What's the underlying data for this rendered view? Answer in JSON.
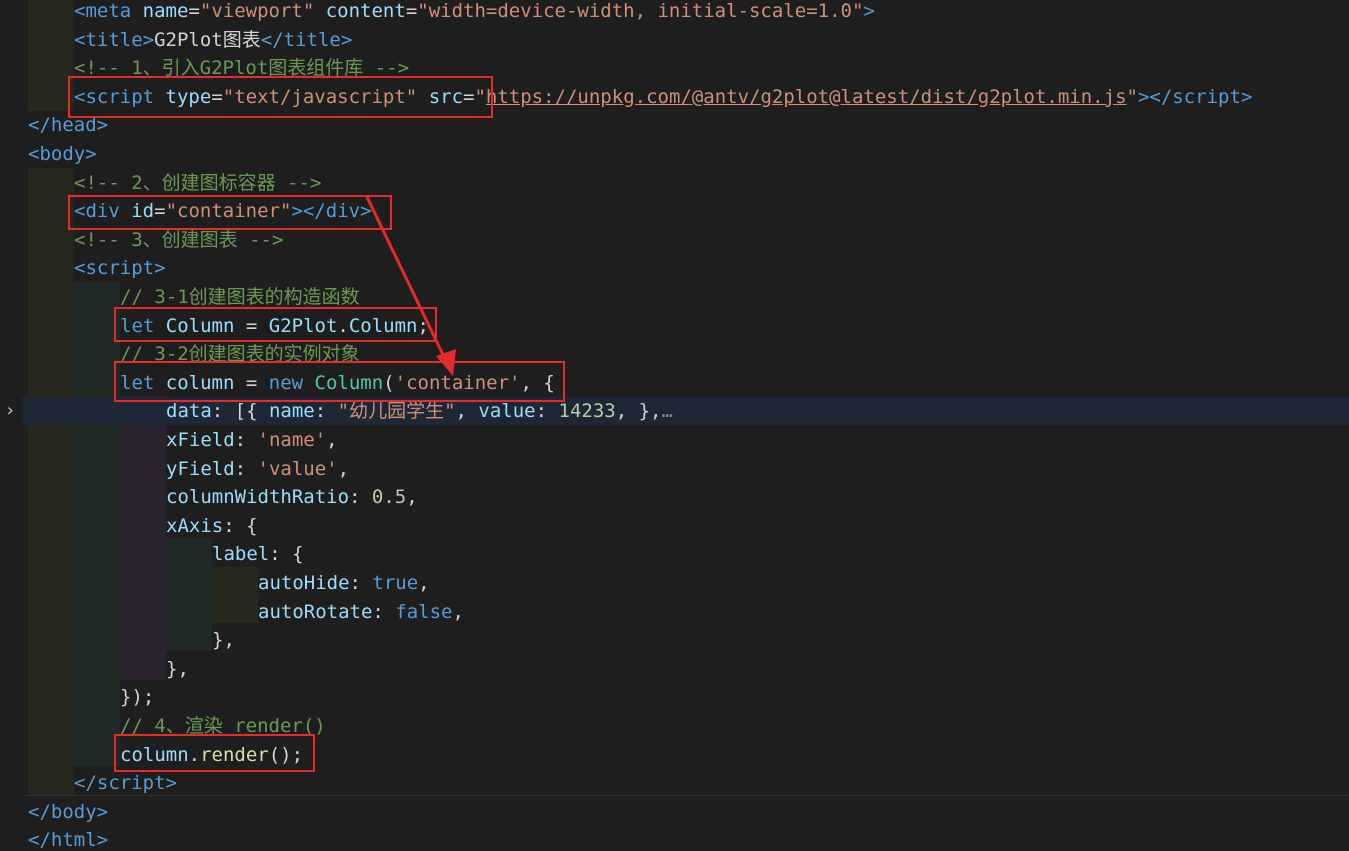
{
  "editor": {
    "colors": {
      "background": "#1e1e1e",
      "current_line": "#1d2736",
      "annotation_red": "#e52b2b"
    },
    "fold_icon": "chevron-right-icon",
    "lines": [
      [
        {
          "t": "<",
          "c": "tag"
        },
        {
          "t": "meta",
          "c": "tag"
        },
        {
          "t": " "
        },
        {
          "t": "name",
          "c": "attr"
        },
        {
          "t": "="
        },
        {
          "t": "\"viewport\"",
          "c": "str"
        },
        {
          "t": " "
        },
        {
          "t": "content",
          "c": "attr"
        },
        {
          "t": "="
        },
        {
          "t": "\"width=device-width, initial-scale=1.0\"",
          "c": "str"
        },
        {
          "t": ">",
          "c": "tag"
        }
      ],
      [
        {
          "t": "<",
          "c": "tag"
        },
        {
          "t": "title",
          "c": "tag"
        },
        {
          "t": ">",
          "c": "tag"
        },
        {
          "t": "G2Plot图表",
          "c": "plain"
        },
        {
          "t": "</",
          "c": "tag"
        },
        {
          "t": "title",
          "c": "tag"
        },
        {
          "t": ">",
          "c": "tag"
        }
      ],
      [
        {
          "t": "<!-- 1、引入G2Plot图表组件库 -->",
          "c": "cmt"
        }
      ],
      [
        {
          "t": "<",
          "c": "tag"
        },
        {
          "t": "script",
          "c": "tag"
        },
        {
          "t": " "
        },
        {
          "t": "type",
          "c": "attr"
        },
        {
          "t": "="
        },
        {
          "t": "\"text/javascript\"",
          "c": "str"
        },
        {
          "t": " "
        },
        {
          "t": "src",
          "c": "attr"
        },
        {
          "t": "="
        },
        {
          "t": "\"",
          "c": "str"
        },
        {
          "t": "https://unpkg.com/@antv/g2plot@latest/dist/g2plot.min.js",
          "c": "str link"
        },
        {
          "t": "\"",
          "c": "str"
        },
        {
          "t": "></",
          "c": "tag"
        },
        {
          "t": "script",
          "c": "tag"
        },
        {
          "t": ">",
          "c": "tag"
        }
      ],
      [
        {
          "t": "</",
          "c": "tag"
        },
        {
          "t": "head",
          "c": "tag"
        },
        {
          "t": ">",
          "c": "tag"
        }
      ],
      [
        {
          "t": "<",
          "c": "tag"
        },
        {
          "t": "body",
          "c": "tag"
        },
        {
          "t": ">",
          "c": "tag"
        }
      ],
      [
        {
          "t": "<!-- 2、创建图标容器 -->",
          "c": "cmt"
        }
      ],
      [
        {
          "t": "<",
          "c": "tag"
        },
        {
          "t": "div",
          "c": "tag"
        },
        {
          "t": " "
        },
        {
          "t": "id",
          "c": "attr"
        },
        {
          "t": "="
        },
        {
          "t": "\"container\"",
          "c": "str"
        },
        {
          "t": "></",
          "c": "tag"
        },
        {
          "t": "div",
          "c": "tag"
        },
        {
          "t": ">",
          "c": "tag"
        }
      ],
      [
        {
          "t": "<!-- 3、创建图表 -->",
          "c": "cmt"
        }
      ],
      [
        {
          "t": "<",
          "c": "tag"
        },
        {
          "t": "script",
          "c": "tag"
        },
        {
          "t": ">",
          "c": "tag"
        }
      ],
      [
        {
          "t": "// 3-1创建图表的构造函数",
          "c": "cmt"
        }
      ],
      [
        {
          "t": "let",
          "c": "kw"
        },
        {
          "t": " "
        },
        {
          "t": "Column",
          "c": "var"
        },
        {
          "t": " = "
        },
        {
          "t": "G2Plot",
          "c": "var"
        },
        {
          "t": "."
        },
        {
          "t": "Column",
          "c": "var"
        },
        {
          "t": ";"
        }
      ],
      [
        {
          "t": "// 3-2创建图表的实例对象",
          "c": "cmt"
        }
      ],
      [
        {
          "t": "let",
          "c": "kw"
        },
        {
          "t": " "
        },
        {
          "t": "column",
          "c": "var"
        },
        {
          "t": " = "
        },
        {
          "t": "new",
          "c": "kw"
        },
        {
          "t": " "
        },
        {
          "t": "Column",
          "c": "type"
        },
        {
          "t": "("
        },
        {
          "t": "'container'",
          "c": "str"
        },
        {
          "t": ", {"
        }
      ],
      [
        {
          "t": "data",
          "c": "var"
        },
        {
          "t": ": [{ "
        },
        {
          "t": "name",
          "c": "var"
        },
        {
          "t": ": "
        },
        {
          "t": "\"幼儿园学生\"",
          "c": "str"
        },
        {
          "t": ", "
        },
        {
          "t": "value",
          "c": "var"
        },
        {
          "t": ": "
        },
        {
          "t": "14233",
          "c": "num"
        },
        {
          "t": ", },"
        },
        {
          "t": "…",
          "c": "fold-ellipsis"
        }
      ],
      [
        {
          "t": "xField",
          "c": "var"
        },
        {
          "t": ": "
        },
        {
          "t": "'name'",
          "c": "str"
        },
        {
          "t": ","
        }
      ],
      [
        {
          "t": "yField",
          "c": "var"
        },
        {
          "t": ": "
        },
        {
          "t": "'value'",
          "c": "str"
        },
        {
          "t": ","
        }
      ],
      [
        {
          "t": "columnWidthRatio",
          "c": "var"
        },
        {
          "t": ": "
        },
        {
          "t": "0.5",
          "c": "num"
        },
        {
          "t": ","
        }
      ],
      [
        {
          "t": "xAxis",
          "c": "var"
        },
        {
          "t": ": {"
        }
      ],
      [
        {
          "t": "label",
          "c": "var"
        },
        {
          "t": ": {"
        }
      ],
      [
        {
          "t": "autoHide",
          "c": "var"
        },
        {
          "t": ": "
        },
        {
          "t": "true",
          "c": "kw"
        },
        {
          "t": ","
        }
      ],
      [
        {
          "t": "autoRotate",
          "c": "var"
        },
        {
          "t": ": "
        },
        {
          "t": "false",
          "c": "kw"
        },
        {
          "t": ","
        }
      ],
      [
        {
          "t": "},"
        }
      ],
      [
        {
          "t": "},"
        }
      ],
      [
        {
          "t": "});"
        }
      ],
      [
        {
          "t": "// 4、渲染 render()",
          "c": "cmt"
        }
      ],
      [
        {
          "t": "column",
          "c": "var"
        },
        {
          "t": "."
        },
        {
          "t": "render",
          "c": "fn"
        },
        {
          "t": "();"
        }
      ],
      [
        {
          "t": "</",
          "c": "tag"
        },
        {
          "t": "script",
          "c": "tag"
        },
        {
          "t": ">",
          "c": "tag"
        }
      ],
      [
        {
          "t": "</",
          "c": "tag"
        },
        {
          "t": "body",
          "c": "tag"
        },
        {
          "t": ">",
          "c": "tag"
        }
      ],
      [
        {
          "t": "</",
          "c": "tag"
        },
        {
          "t": "html",
          "c": "tag"
        },
        {
          "t": ">",
          "c": "tag"
        }
      ]
    ]
  }
}
